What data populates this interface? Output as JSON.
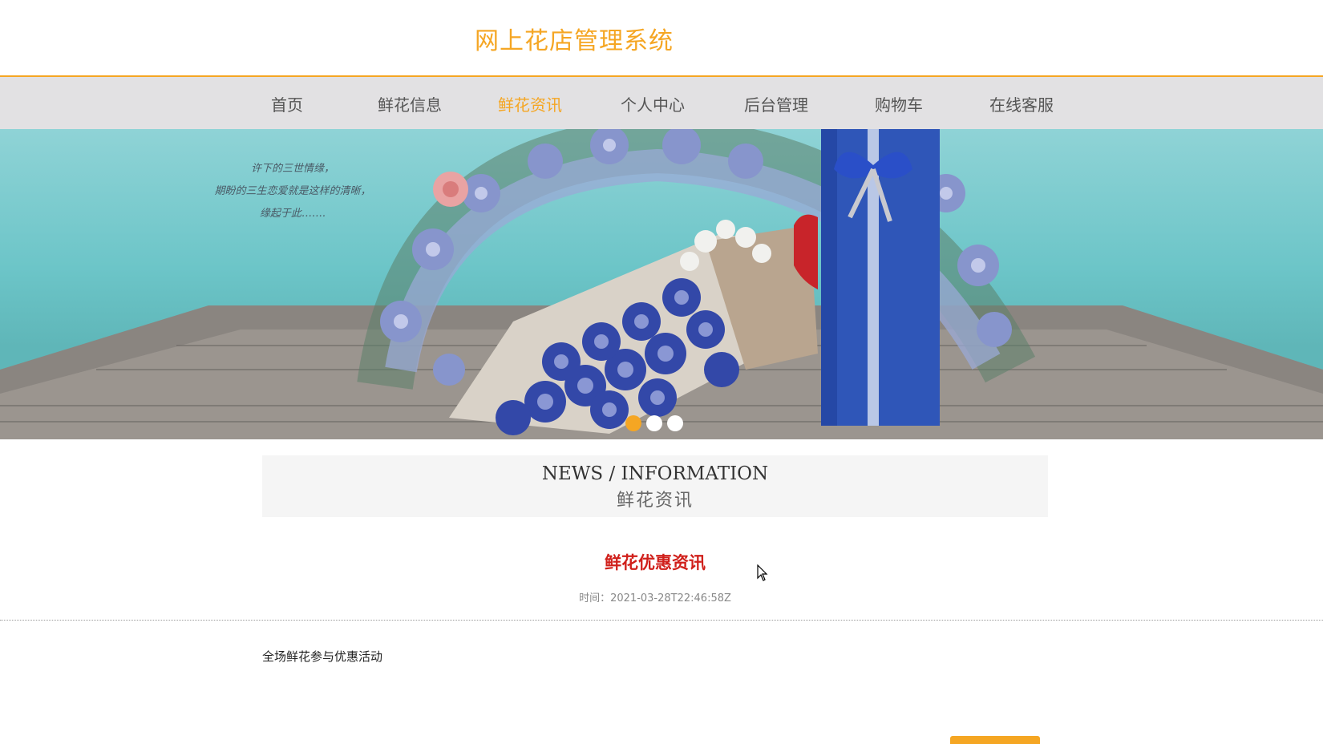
{
  "header": {
    "site_title": "网上花店管理系统"
  },
  "nav": {
    "items": [
      {
        "label": "首页",
        "active": false
      },
      {
        "label": "鲜花信息",
        "active": false
      },
      {
        "label": "鲜花资讯",
        "active": true
      },
      {
        "label": "个人中心",
        "active": false
      },
      {
        "label": "后台管理",
        "active": false
      },
      {
        "label": "购物车",
        "active": false
      },
      {
        "label": "在线客服",
        "active": false
      }
    ]
  },
  "banner": {
    "slides": 3,
    "active_slide": 1,
    "poem_lines": [
      "许下的三世情缘，",
      "期盼的三生恋爱就是这样的清晰，",
      "缘起于此……."
    ]
  },
  "section": {
    "title_en": "NEWS / INFORMATION",
    "title_cn": "鲜花资讯"
  },
  "article": {
    "title": "鲜花优惠资讯",
    "time_label": "时间：",
    "time_value": "2021-03-28T22:46:58Z",
    "body": "全场鲜花参与优惠活动"
  },
  "colors": {
    "accent": "#f5a623",
    "title_red": "#d0201b",
    "nav_bg": "#e2e1e3"
  }
}
